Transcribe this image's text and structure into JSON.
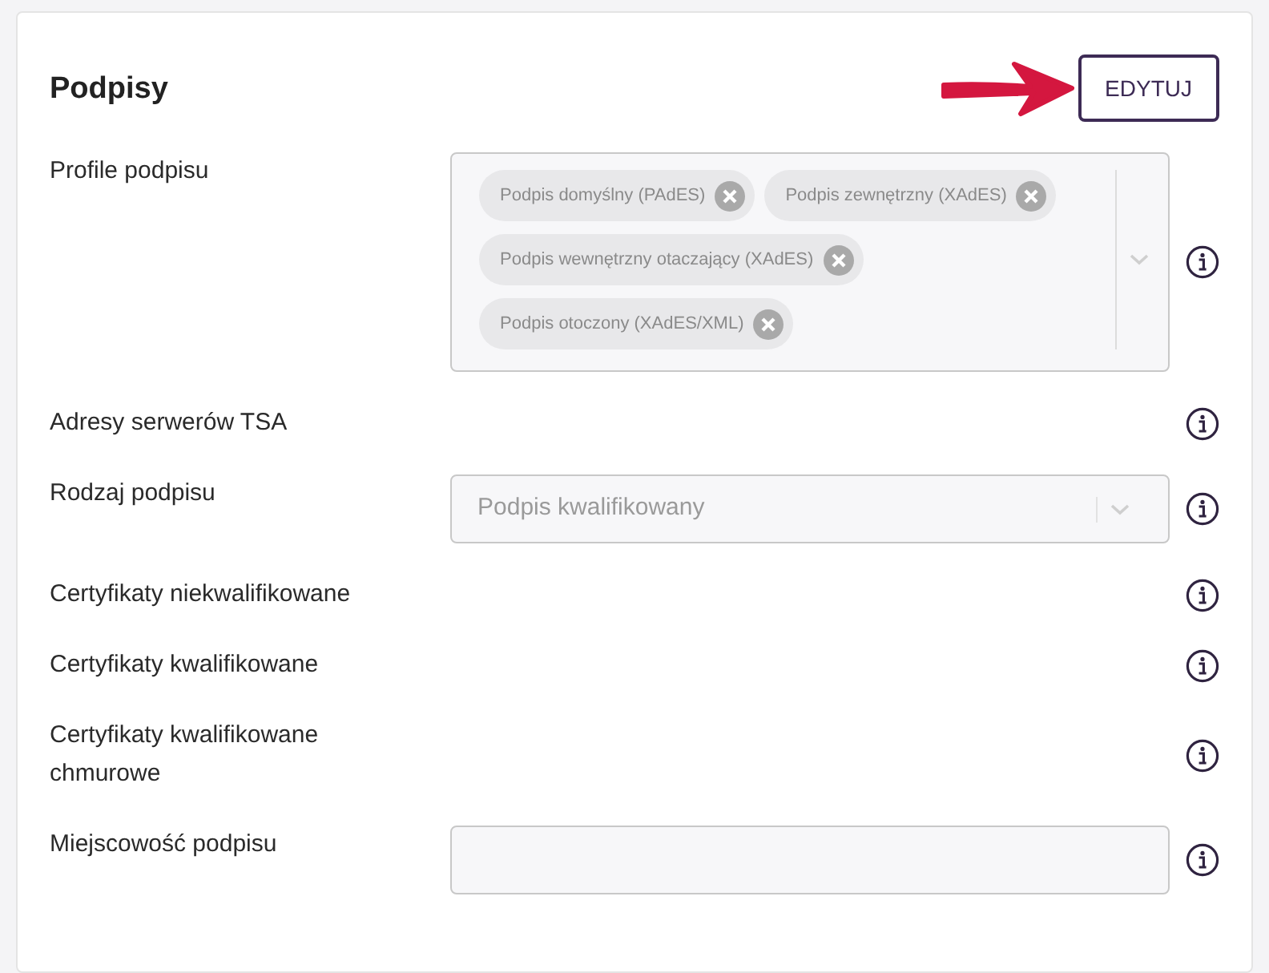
{
  "title": "Podpisy",
  "edit_button": "EDYTUJ",
  "fields": [
    {
      "kind": "multiselect",
      "label": "Profile podpisu",
      "chips": [
        "Podpis domyślny (PAdES)",
        "Podpis zewnętrzny (XAdES)",
        "Podpis wewnętrzny otaczający (XAdES)",
        "Podpis otoczony (XAdES/XML)"
      ]
    },
    {
      "kind": "none",
      "label": "Adresy serwerów TSA"
    },
    {
      "kind": "select",
      "label": "Rodzaj podpisu",
      "value": "Podpis kwalifikowany"
    },
    {
      "kind": "none",
      "label": "Certyfikaty niekwalifikowane"
    },
    {
      "kind": "none",
      "label": "Certyfikaty kwalifikowane"
    },
    {
      "kind": "none",
      "label": "Certyfikaty kwalifikowane chmurowe"
    },
    {
      "kind": "text",
      "label": "Miejscowość podpisu"
    }
  ]
}
